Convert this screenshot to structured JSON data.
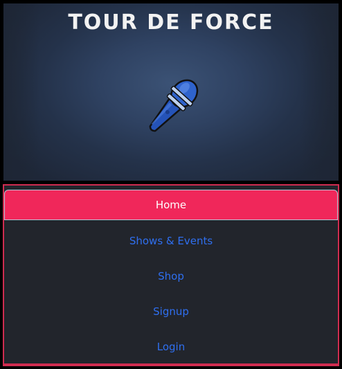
{
  "header": {
    "title": "TOUR DE FORCE",
    "logo_icon": "microphone-icon"
  },
  "nav": {
    "items": [
      {
        "label": "Home",
        "active": true
      },
      {
        "label": "Shows & Events",
        "active": false
      },
      {
        "label": "Shop",
        "active": false
      },
      {
        "label": "Signup",
        "active": false
      },
      {
        "label": "Login",
        "active": false
      }
    ]
  },
  "colors": {
    "accent": "#f0275a",
    "link": "#2f6ff0",
    "menu_bg": "#22252c",
    "hero_bg": "#2f4262"
  }
}
